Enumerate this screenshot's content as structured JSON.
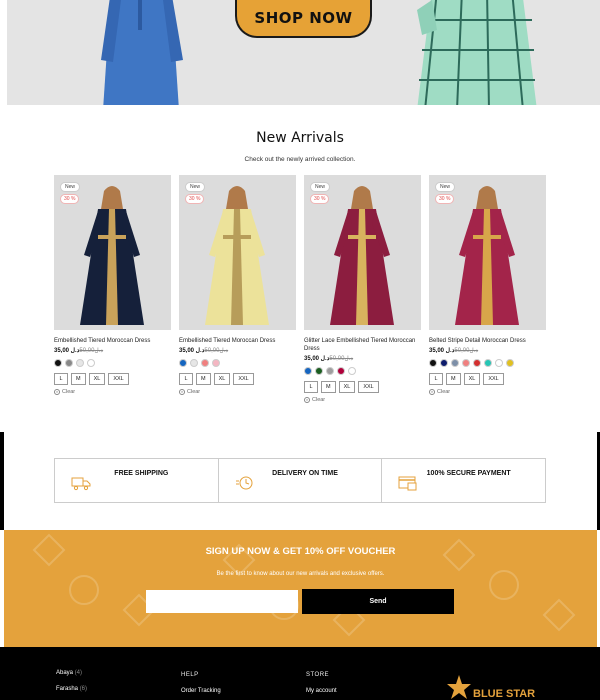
{
  "hero": {
    "cta_label": "SHOP NOW"
  },
  "new_arrivals": {
    "title": "New Arrivals",
    "subtitle": "Check out the newly arrived collection.",
    "products": [
      {
        "new_badge": "New",
        "discount_badge": "30 %",
        "name": "Embellished Tiered Moroccan Dress",
        "old_price": "د.ل50,00",
        "new_price": "د.ل 35,00",
        "dress_color": "#15203a",
        "trim_color": "#c9a25a",
        "swatches": [
          "#111111",
          "#888888",
          "#e6e6e6",
          "#ffffff"
        ],
        "sizes": [
          "L",
          "M",
          "XL",
          "XXL"
        ],
        "clear_label": "Clear"
      },
      {
        "new_badge": "New",
        "discount_badge": "30 %",
        "name": "Embellished Tiered Moroccan Dress",
        "old_price": "د.ل50,00",
        "new_price": "د.ل 35,00",
        "dress_color": "#ece29a",
        "trim_color": "#b79d5a",
        "swatches": [
          "#1565c0",
          "#e6e6e6",
          "#f08080",
          "#f4b6c2"
        ],
        "sizes": [
          "L",
          "M",
          "XL",
          "XXL"
        ],
        "clear_label": "Clear"
      },
      {
        "new_badge": "New",
        "discount_badge": "30 %",
        "name": "Glitter Lace Embellished Tiered Moroccan Dress",
        "old_price": "د.ل50,00",
        "new_price": "د.ل 35,00",
        "dress_color": "#8c1d3f",
        "trim_color": "#d8b35e",
        "swatches": [
          "#1565c0",
          "#1b5e20",
          "#9e9e9e",
          "#b0003a",
          "#ffffff"
        ],
        "sizes": [
          "L",
          "M",
          "XL",
          "XXL"
        ],
        "clear_label": "Clear"
      },
      {
        "new_badge": "New",
        "discount_badge": "30 %",
        "name": "Belted Stripe Detail Moroccan Dress",
        "old_price": "د.ل50,00",
        "new_price": "د.ل 35,00",
        "dress_color": "#a3244a",
        "trim_color": "#d8a64a",
        "swatches": [
          "#111111",
          "#0d1b6b",
          "#7d8fa8",
          "#f08080",
          "#d32f2f",
          "#26c6b5",
          "#ffffff",
          "#e0c020"
        ],
        "sizes": [
          "L",
          "M",
          "XL",
          "XXL"
        ],
        "clear_label": "Clear"
      }
    ]
  },
  "features": [
    {
      "label": "FREE SHIPPING",
      "icon": "truck-icon"
    },
    {
      "label": "DELIVERY ON TIME",
      "icon": "clock-icon"
    },
    {
      "label": "100% SECURE PAYMENT",
      "icon": "card-icon"
    }
  ],
  "signup": {
    "title": "SIGN UP NOW & GET 10% OFF VOUCHER",
    "subtitle": "Be the first to know about our new arrivals and exclusive offers.",
    "email_placeholder": "",
    "send_label": "Send"
  },
  "footer": {
    "categories": [
      {
        "name": "Abaya",
        "count": "(4)"
      },
      {
        "name": "Farasha",
        "count": "(6)"
      }
    ],
    "help": {
      "heading": "HELP",
      "link": "Order Tracking"
    },
    "store": {
      "heading": "STORE",
      "link": "My account"
    },
    "logo_text": "BLUE STAR"
  },
  "colors": {
    "accent": "#e4a23c",
    "dark": "#000000"
  }
}
